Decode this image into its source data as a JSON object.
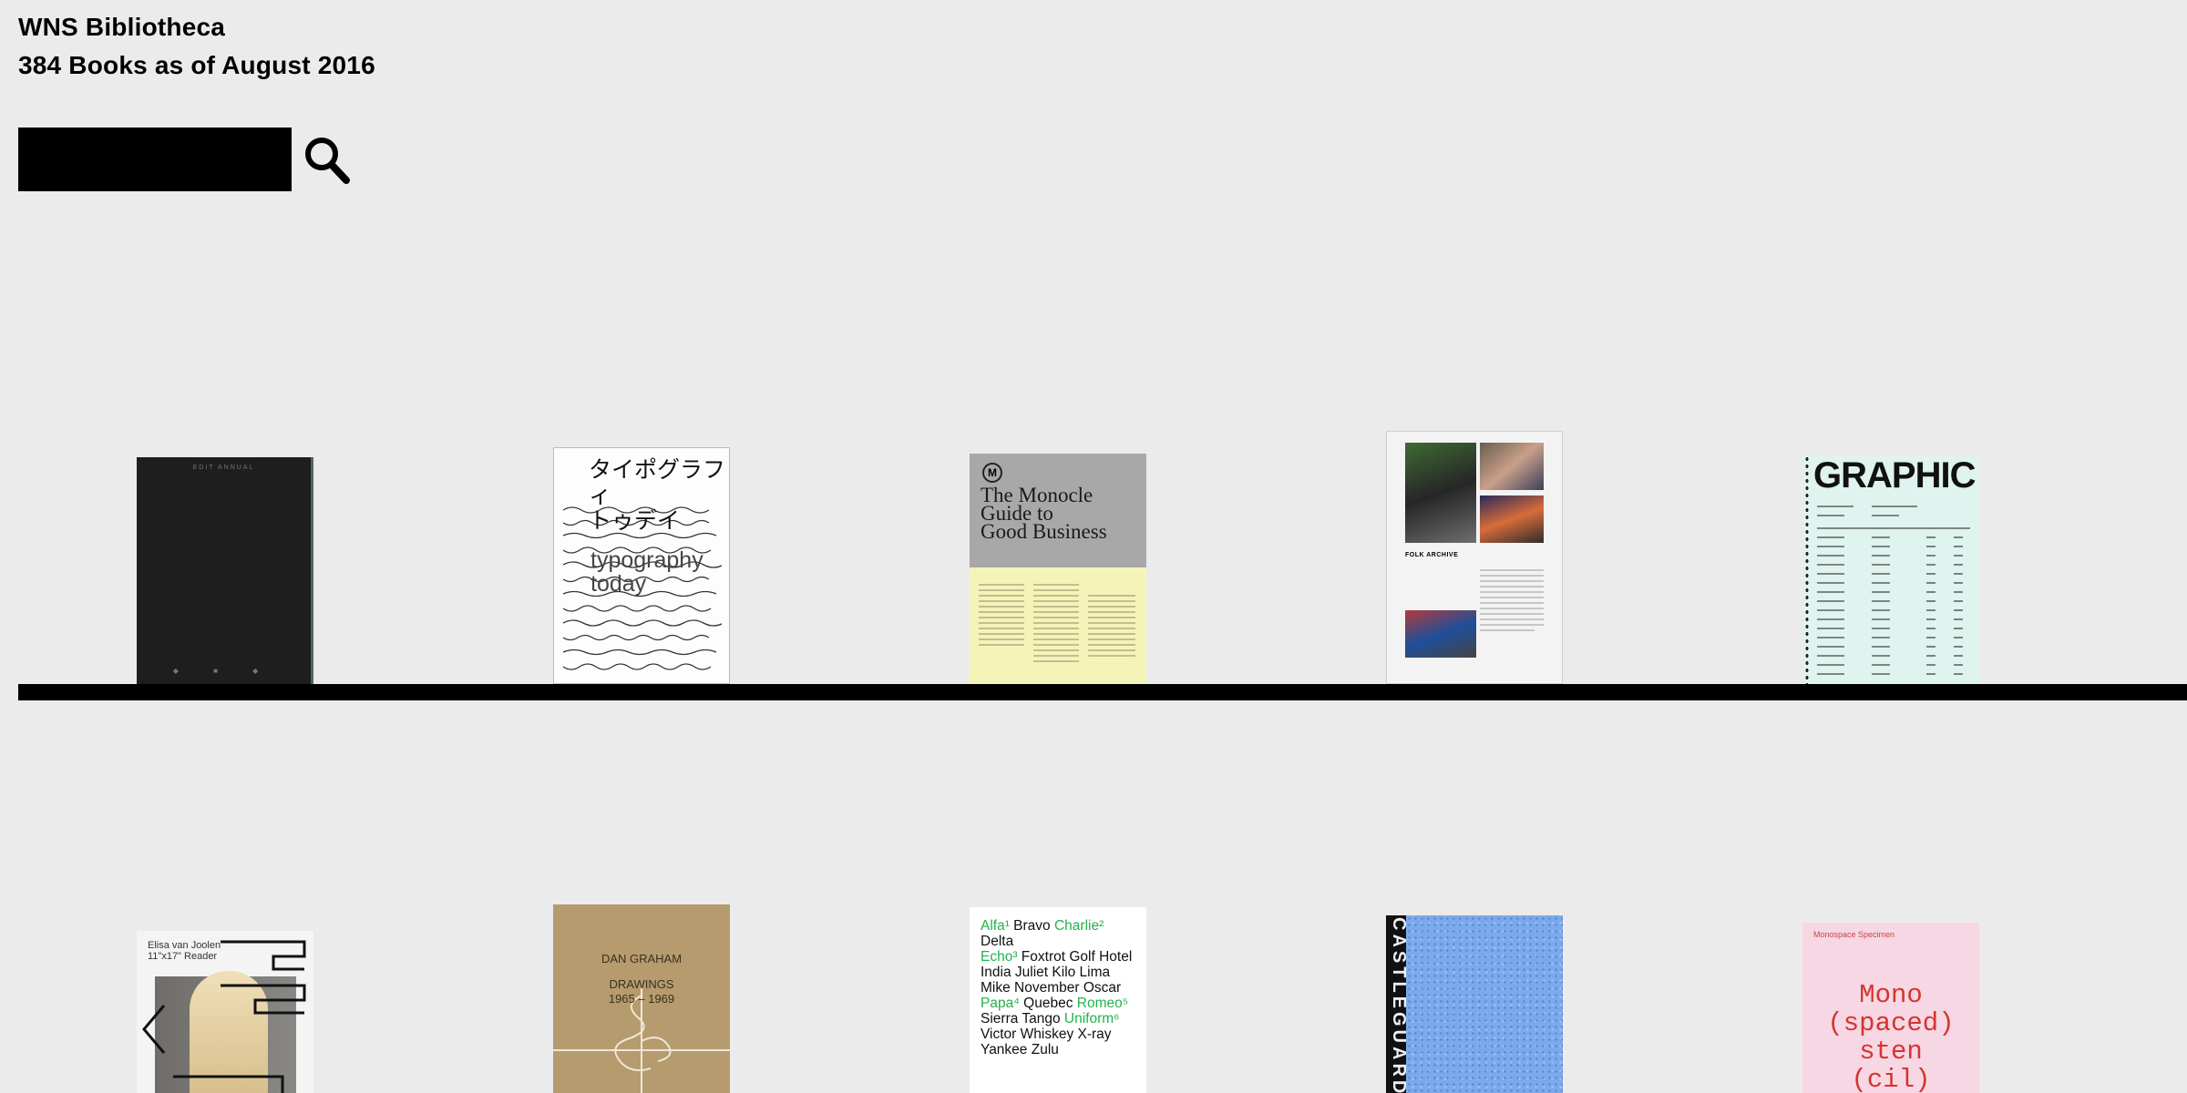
{
  "header": {
    "title": "WNS Bibliotheca",
    "subtitle": "384 Books as of August 2016"
  },
  "search": {
    "value": "",
    "placeholder": ""
  },
  "books": [
    {
      "top_text": "EDIT     ANNUAL",
      "bottom_text": "◆  ■  ◆"
    },
    {
      "jp_title": "タイポグラフィ\nトゥデイ",
      "title": "typography\ntoday"
    },
    {
      "logo": "M",
      "title": "The Monocle\nGuide to\nGood Business"
    },
    {
      "label": "FOLK ARCHIVE"
    },
    {
      "title": "GRAPHIC"
    },
    {
      "author": "Elisa van Joolen\n11\"x17\" Reader"
    },
    {
      "author": "DAN GRAHAM",
      "title": "DRAWINGS\n1965 – 1969"
    },
    {
      "lines": [
        [
          [
            "Alfa¹",
            true
          ],
          [
            " Bravo ",
            false
          ],
          [
            "Charlie²",
            true
          ],
          [
            " Delta",
            false
          ]
        ],
        [
          [
            "Echo³",
            true
          ],
          [
            " Foxtrot Golf Hotel",
            false
          ]
        ],
        [
          [
            "India Juliet Kilo Lima",
            false
          ]
        ],
        [
          [
            "Mike November Oscar",
            false
          ]
        ],
        [
          [
            "Papa⁴",
            true
          ],
          [
            " Quebec ",
            false
          ],
          [
            "Romeo⁵",
            true
          ]
        ],
        [
          [
            "Sierra Tango ",
            false
          ],
          [
            "Uniform⁶",
            true
          ]
        ],
        [
          [
            "Victor Whiskey X-ray",
            false
          ]
        ],
        [
          [
            "Yankee Zulu",
            false
          ]
        ]
      ]
    },
    {
      "spine": "CASTLEGUARD"
    },
    {
      "top": "Monospace Specimen",
      "title": "Mono\n(spaced)\nsten\n(cil)"
    }
  ],
  "colors": {
    "background": "#ebebeb",
    "shelf": "#000000",
    "search_bg": "#000000",
    "accent_green": "#21b24c",
    "accent_red": "#d6342f"
  },
  "icons": {
    "search": "search-icon"
  }
}
